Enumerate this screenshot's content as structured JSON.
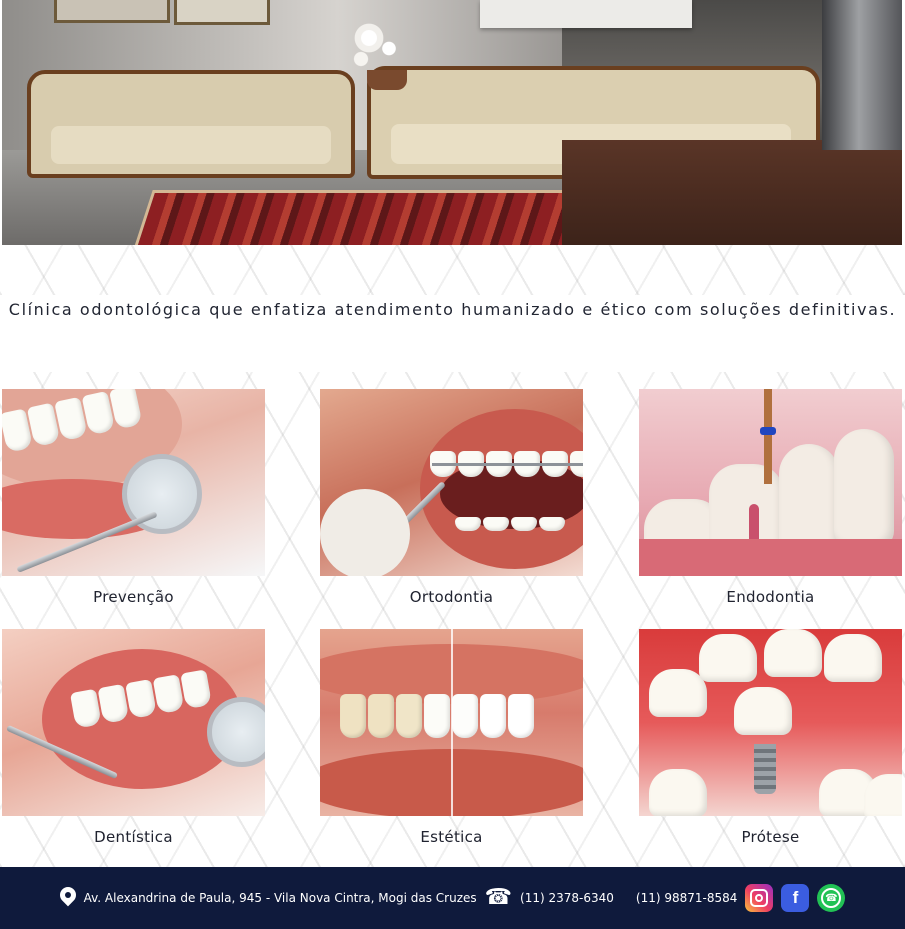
{
  "tagline": "Clínica odontológica que enfatiza atendimento humanizado e ético com soluções definitivas.",
  "services": [
    {
      "label": "Prevenção",
      "icon": "dental-mirror-smile-photo"
    },
    {
      "label": "Ortodontia",
      "icon": "braces-photo"
    },
    {
      "label": "Endodontia",
      "icon": "root-canal-photo"
    },
    {
      "label": "Dentística",
      "icon": "smile-mirror-photo"
    },
    {
      "label": "Estética",
      "icon": "whitening-photo"
    },
    {
      "label": "Prótese",
      "icon": "implant-photo"
    }
  ],
  "footer": {
    "address": "Av. Alexandrina de Paula, 945 - Vila Nova Cintra, Mogi das Cruzes",
    "phone1": "(11) 2378-6340",
    "phone2": "(11) 98871-8584",
    "icons": [
      "location-pin-icon",
      "phone-icon",
      "instagram-icon",
      "facebook-icon",
      "whatsapp-icon"
    ],
    "background_color": "#0f1a3c"
  }
}
